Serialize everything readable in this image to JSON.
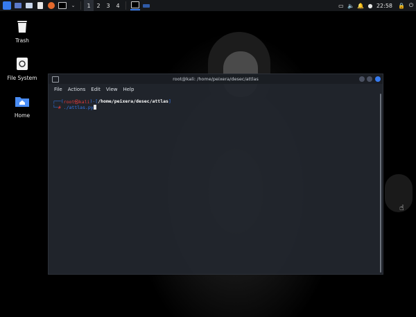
{
  "colors": {
    "accent": "#367bf0",
    "prompt_root": "#e53b3b",
    "panel_bg": "#16181b"
  },
  "panel": {
    "workspaces": [
      "1",
      "2",
      "3",
      "4"
    ],
    "active_workspace": "1",
    "clock": "22:58"
  },
  "desktop": {
    "icons": [
      {
        "label": "Trash",
        "icon": "trash-icon"
      },
      {
        "label": "File System",
        "icon": "drive-icon"
      },
      {
        "label": "Home",
        "icon": "home-folder-icon"
      }
    ]
  },
  "terminal": {
    "title": "root@kali: /home/peixera/desec/attlas",
    "menu": [
      "File",
      "Actions",
      "Edit",
      "View",
      "Help"
    ],
    "prompt": {
      "user_host": "root㉿kali",
      "cwd": "/home/peixera/desec/attlas",
      "symbol": "#",
      "command": "./attlas.py"
    }
  }
}
